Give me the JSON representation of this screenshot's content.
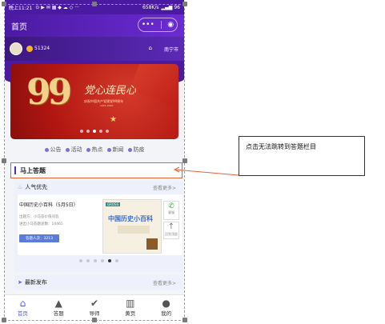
{
  "status_bar": {
    "time": "晚上11:21",
    "speed": "658K/s",
    "battery": "96"
  },
  "header": {
    "title": "首页",
    "capsule_more": "•••",
    "capsule_close": "◉"
  },
  "user": {
    "coins": "51324",
    "city": "南宁市"
  },
  "banner": {
    "number": "99",
    "slogan": "党心连民心",
    "subtitle": "庆祝中国共产党建党99周年",
    "subtitle2": "1921-2020"
  },
  "categories": [
    "公告",
    "活动",
    "热点",
    "新闻",
    "防疫"
  ],
  "answer": {
    "title": "马上答题"
  },
  "popular": {
    "heading": "人气优先",
    "more": "查看更多>",
    "card": {
      "title": "中国历史小百科（5月5日）",
      "publisher": "出题方：小马答价值问答",
      "count": "进出小马答题总数：14465",
      "button": "答题人次：3213"
    },
    "image": {
      "logo": "GROSS",
      "title": "中国历史小百科"
    },
    "side_wechat": "客服",
    "side_top": "回到顶部"
  },
  "latest": {
    "heading": "最新发布",
    "more": "查看更多>"
  },
  "tabs": [
    {
      "label": "首页",
      "icon": "⌂",
      "active": true
    },
    {
      "label": "答题",
      "icon": "▲"
    },
    {
      "label": "导师",
      "icon": "✔"
    },
    {
      "label": "黄页",
      "icon": "▥"
    },
    {
      "label": "我的",
      "icon": "●"
    }
  ],
  "annotation": {
    "text": "点击无法跳转到答题栏目"
  },
  "colors": {
    "primary": "#4a1aa0",
    "accent": "#5b5bd8",
    "annotation": "#e0643a"
  }
}
